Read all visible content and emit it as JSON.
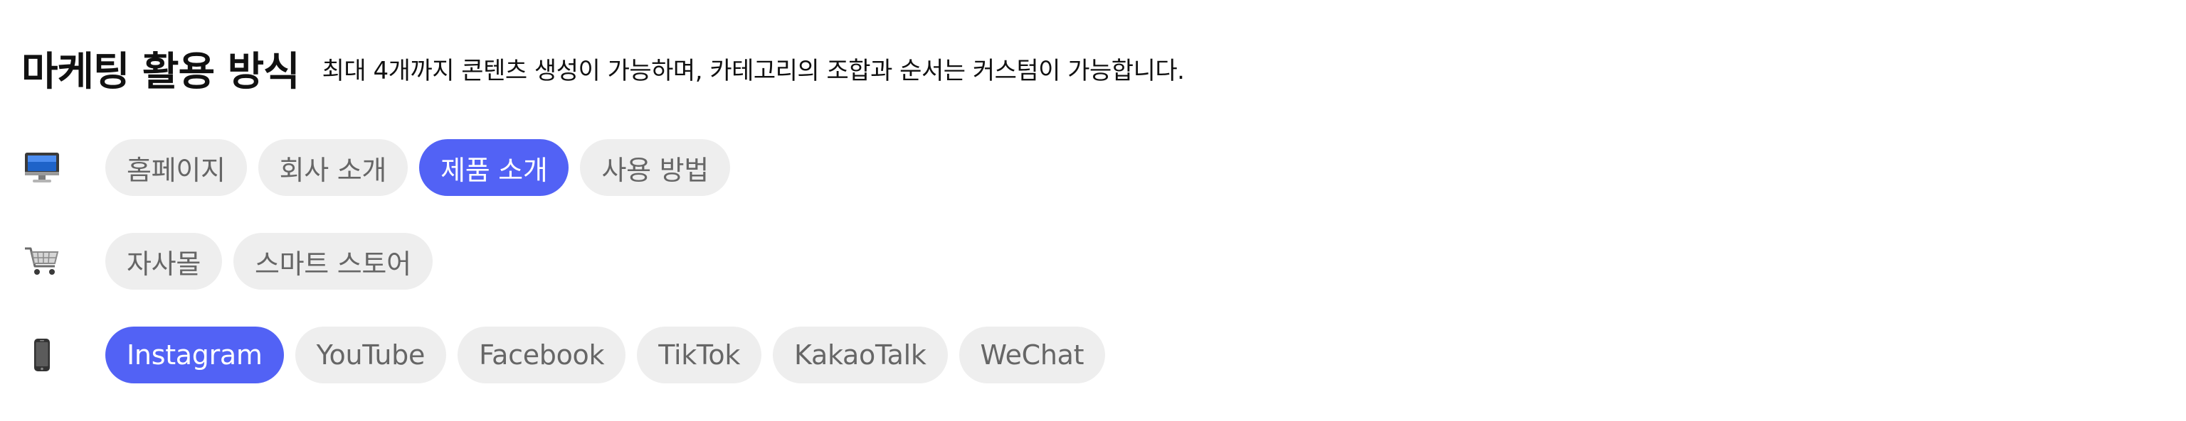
{
  "header": {
    "title": "마케팅 활용 방식",
    "subtitle": "최대 4개까지 콘텐츠 생성이 가능하며, 카테고리의 조합과 순서는 커스텀이 가능합니다."
  },
  "colors": {
    "accent": "#5262f5",
    "chip_bg": "#eeeeee",
    "chip_text": "#666666"
  },
  "rows": [
    {
      "icon": "desktop-computer-icon",
      "chips": [
        {
          "label": "홈페이지",
          "selected": false
        },
        {
          "label": "회사 소개",
          "selected": false
        },
        {
          "label": "제품 소개",
          "selected": true
        },
        {
          "label": "사용 방법",
          "selected": false
        }
      ]
    },
    {
      "icon": "shopping-cart-icon",
      "chips": [
        {
          "label": "자사몰",
          "selected": false
        },
        {
          "label": "스마트 스토어",
          "selected": false
        }
      ]
    },
    {
      "icon": "mobile-phone-icon",
      "chips": [
        {
          "label": "Instagram",
          "selected": true
        },
        {
          "label": "YouTube",
          "selected": false
        },
        {
          "label": "Facebook",
          "selected": false
        },
        {
          "label": "TikTok",
          "selected": false
        },
        {
          "label": "KakaoTalk",
          "selected": false
        },
        {
          "label": "WeChat",
          "selected": false
        }
      ]
    }
  ]
}
